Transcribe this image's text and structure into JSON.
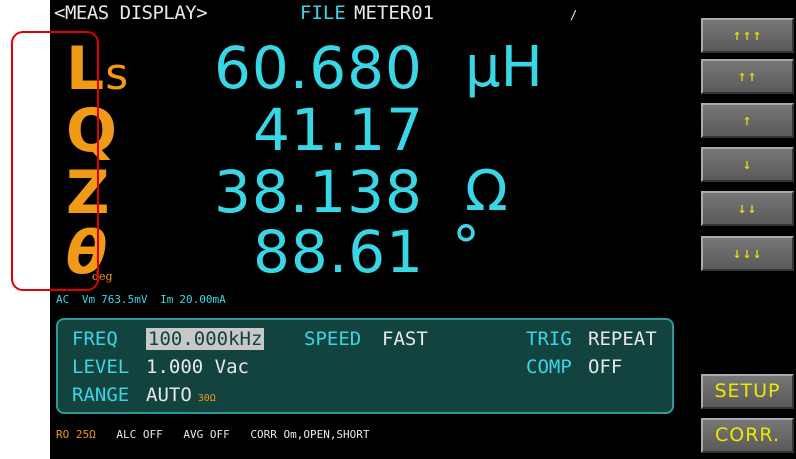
{
  "header": {
    "mode": "<MEAS DISPLAY>",
    "file_label": "FILE",
    "file_name": "METER01",
    "mark": "/"
  },
  "measurements": [
    {
      "param": "L",
      "param_sub": "s",
      "value": "60.680",
      "unit": "μH"
    },
    {
      "param": "Q",
      "value": "41.17",
      "unit": ""
    },
    {
      "param": "Z",
      "value": "38.138",
      "unit": "Ω"
    },
    {
      "param": "θ",
      "param_sub": "deg",
      "value": "88.61",
      "unit": "°"
    }
  ],
  "signal": {
    "mode": "AC",
    "vm_label": "Vm",
    "vm_value": "763.5mV",
    "im_label": "Im",
    "im_value": "20.00mA"
  },
  "settings": {
    "freq_label": "FREQ",
    "freq_value": "100.000kHz",
    "speed_label": "SPEED",
    "speed_value": "FAST",
    "trig_label": "TRIG",
    "trig_value": "REPEAT",
    "level_label": "LEVEL",
    "level_value": "1.000 Vac",
    "comp_label": "COMP",
    "comp_value": "OFF",
    "range_label": "RANGE",
    "range_value": "AUTO",
    "range_sub": "30Ω"
  },
  "status": {
    "ro": "RO 25Ω",
    "alc": "ALC OFF",
    "avg": "AVG OFF",
    "corr": "CORR Om,OPEN,SHORT"
  },
  "side_buttons": {
    "up3": "↑↑↑",
    "up2": "↑↑",
    "up1": "↑",
    "down1": "↓",
    "down2": "↓↓",
    "down3": "↓↓↓",
    "setup": "SETUP",
    "corr": "CORR."
  },
  "colors": {
    "background": "#000000",
    "value_cyan": "#39d6e6",
    "param_orange": "#f09a18",
    "panel_bg": "#13433f",
    "button_text": "#f0e600",
    "highlight_box": "#e00000"
  }
}
